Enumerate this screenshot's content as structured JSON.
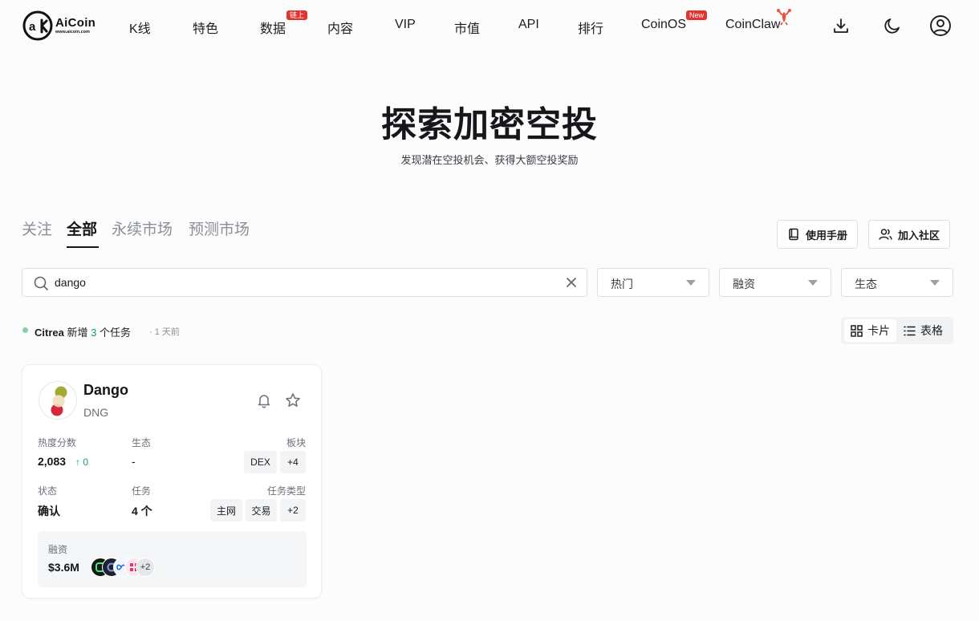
{
  "header": {
    "logo": {
      "name": "AiCoin",
      "url": "www.aicoin.com"
    },
    "nav": [
      {
        "label": "K线"
      },
      {
        "label": "特色"
      },
      {
        "label": "数据",
        "badge": "链上"
      },
      {
        "label": "内容"
      },
      {
        "label": "VIP"
      },
      {
        "label": "市值"
      },
      {
        "label": "API"
      },
      {
        "label": "排行"
      },
      {
        "label": "CoinOS",
        "badge": "New"
      },
      {
        "label": "CoinClaw"
      }
    ],
    "icons": [
      "download-icon",
      "moon-icon",
      "user-icon"
    ]
  },
  "hero": {
    "title": "探索加密空投",
    "subtitle": "发现潜在空投机会、获得大额空投奖励"
  },
  "tabs": [
    {
      "label": "关注",
      "active": false
    },
    {
      "label": "全部",
      "active": true
    },
    {
      "label": "永续市场",
      "active": false
    },
    {
      "label": "预测市场",
      "active": false
    }
  ],
  "actions": {
    "manual": "使用手册",
    "community": "加入社区"
  },
  "search": {
    "value": "dango"
  },
  "filters": [
    {
      "label": "热门"
    },
    {
      "label": "融资"
    },
    {
      "label": "生态"
    }
  ],
  "update": {
    "project": "Citrea",
    "prefix": "新增",
    "count": "3",
    "suffix": "个任务",
    "time": "· 1 天前"
  },
  "view": {
    "card": "卡片",
    "table": "表格",
    "active": "card"
  },
  "card": {
    "name": "Dango",
    "symbol": "DNG",
    "heat_label": "热度分数",
    "heat_value": "2,083",
    "heat_delta": "0",
    "ecosystem_label": "生态",
    "ecosystem_value": "-",
    "sector_label": "板块",
    "sector_chips": [
      "DEX",
      "+4"
    ],
    "status_label": "状态",
    "status_value": "确认",
    "tasks_label": "任务",
    "tasks_value": "4 个",
    "task_type_label": "任务类型",
    "task_type_chips": [
      "主网",
      "交易",
      "+2"
    ],
    "funding_label": "融资",
    "funding_value": "$3.6M",
    "investors_more": "+2",
    "colors": {
      "positive": "#19a55c",
      "badge": "#e2342f"
    }
  }
}
